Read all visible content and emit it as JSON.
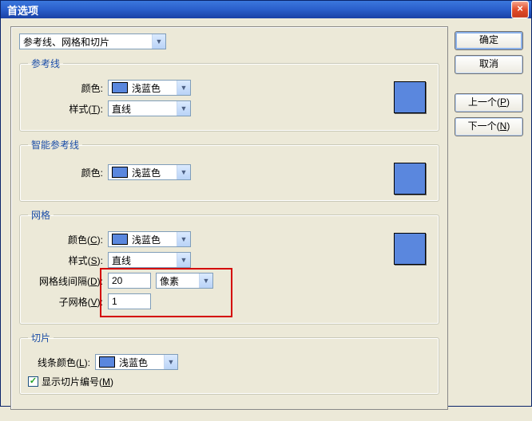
{
  "window": {
    "title": "首选项"
  },
  "buttons": {
    "ok": "确定",
    "cancel": "取消",
    "prev": "上一个(P)",
    "next": "下一个(N)"
  },
  "category": {
    "selected": "参考线、网格和切片"
  },
  "groups": {
    "guides": {
      "legend": "参考线",
      "color_label": "颜色:",
      "color_value": "浅蓝色",
      "style_label": "样式(T):",
      "style_value": "直线",
      "swatch_color": "#5a87de"
    },
    "smart": {
      "legend": "智能参考线",
      "color_label": "颜色:",
      "color_value": "浅蓝色",
      "swatch_color": "#5a87de"
    },
    "grid": {
      "legend": "网格",
      "color_label": "颜色(C):",
      "color_value": "浅蓝色",
      "style_label": "样式(S):",
      "style_value": "直线",
      "spacing_label": "网格线间隔(D):",
      "spacing_value": "20",
      "spacing_unit": "像素",
      "sub_label": "子网格(V):",
      "sub_value": "1",
      "swatch_color": "#5a87de"
    },
    "slices": {
      "legend": "切片",
      "color_label": "线条颜色(L):",
      "color_value": "浅蓝色",
      "show_numbers_label": "显示切片编号(M)",
      "show_numbers_checked": true
    }
  }
}
